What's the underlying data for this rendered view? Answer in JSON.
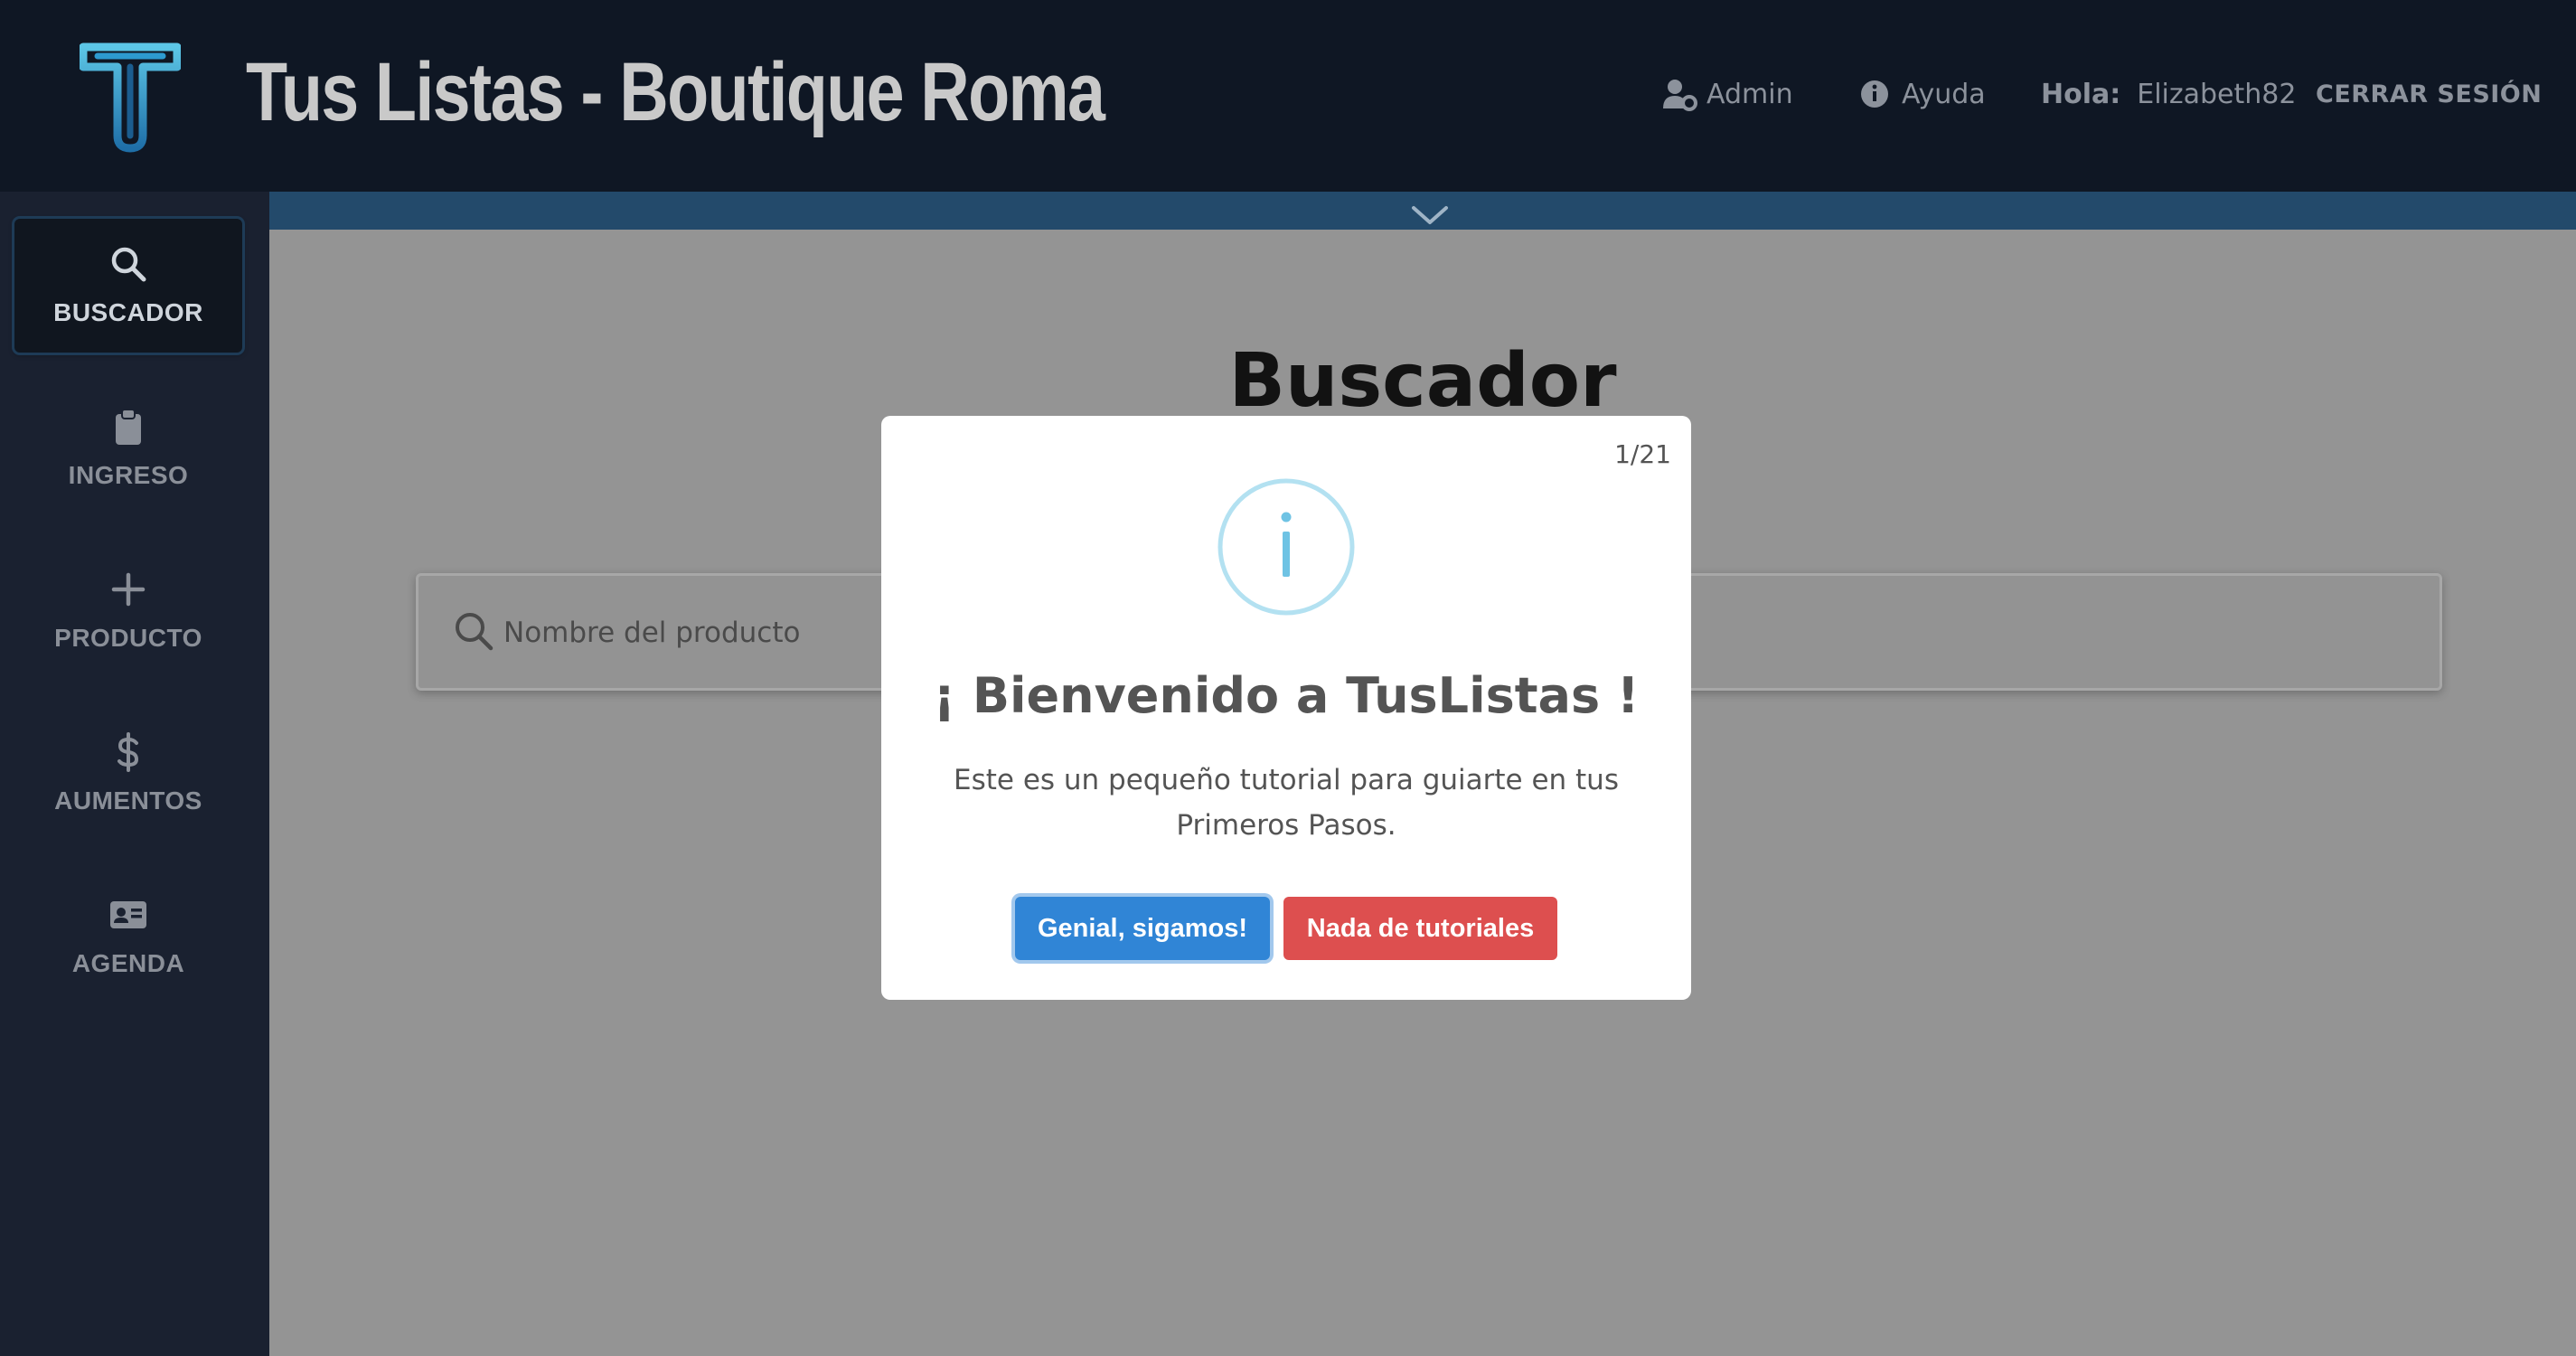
{
  "header": {
    "title": "Tus Listas - Boutique Roma",
    "logo_icon": "tuslistas-logo",
    "nav": {
      "admin_label": "Admin",
      "help_label": "Ayuda",
      "hello_label": "Hola:",
      "username": "Elizabeth82",
      "logout_label": "CERRAR SESIÓN"
    }
  },
  "sidebar": {
    "items": [
      {
        "label": "BUSCADOR",
        "icon": "search-icon",
        "active": true
      },
      {
        "label": "INGRESO",
        "icon": "clipboard-icon",
        "active": false
      },
      {
        "label": "PRODUCTO",
        "icon": "plus-icon",
        "active": false
      },
      {
        "label": "AUMENTOS",
        "icon": "dollar-icon",
        "active": false
      },
      {
        "label": "AGENDA",
        "icon": "contact-card-icon",
        "active": false
      }
    ]
  },
  "main": {
    "title": "Buscador",
    "search": {
      "placeholder": "Nombre del producto",
      "value": ""
    }
  },
  "modal": {
    "step": "1/21",
    "icon": "info-icon",
    "title": "¡ Bienvenido a TusListas !",
    "text": "Este es un pequeño tutorial para guiarte en tus Primeros Pasos.",
    "confirm_label": "Genial, sigamos!",
    "cancel_label": "Nada de tutoriales"
  },
  "colors": {
    "header_bg": "#0f1724",
    "sidebar_bg": "#1a2130",
    "accent_bar": "#234a6b",
    "confirm": "#3085d6",
    "cancel": "#dd4f4f",
    "info": "#87cde8"
  }
}
